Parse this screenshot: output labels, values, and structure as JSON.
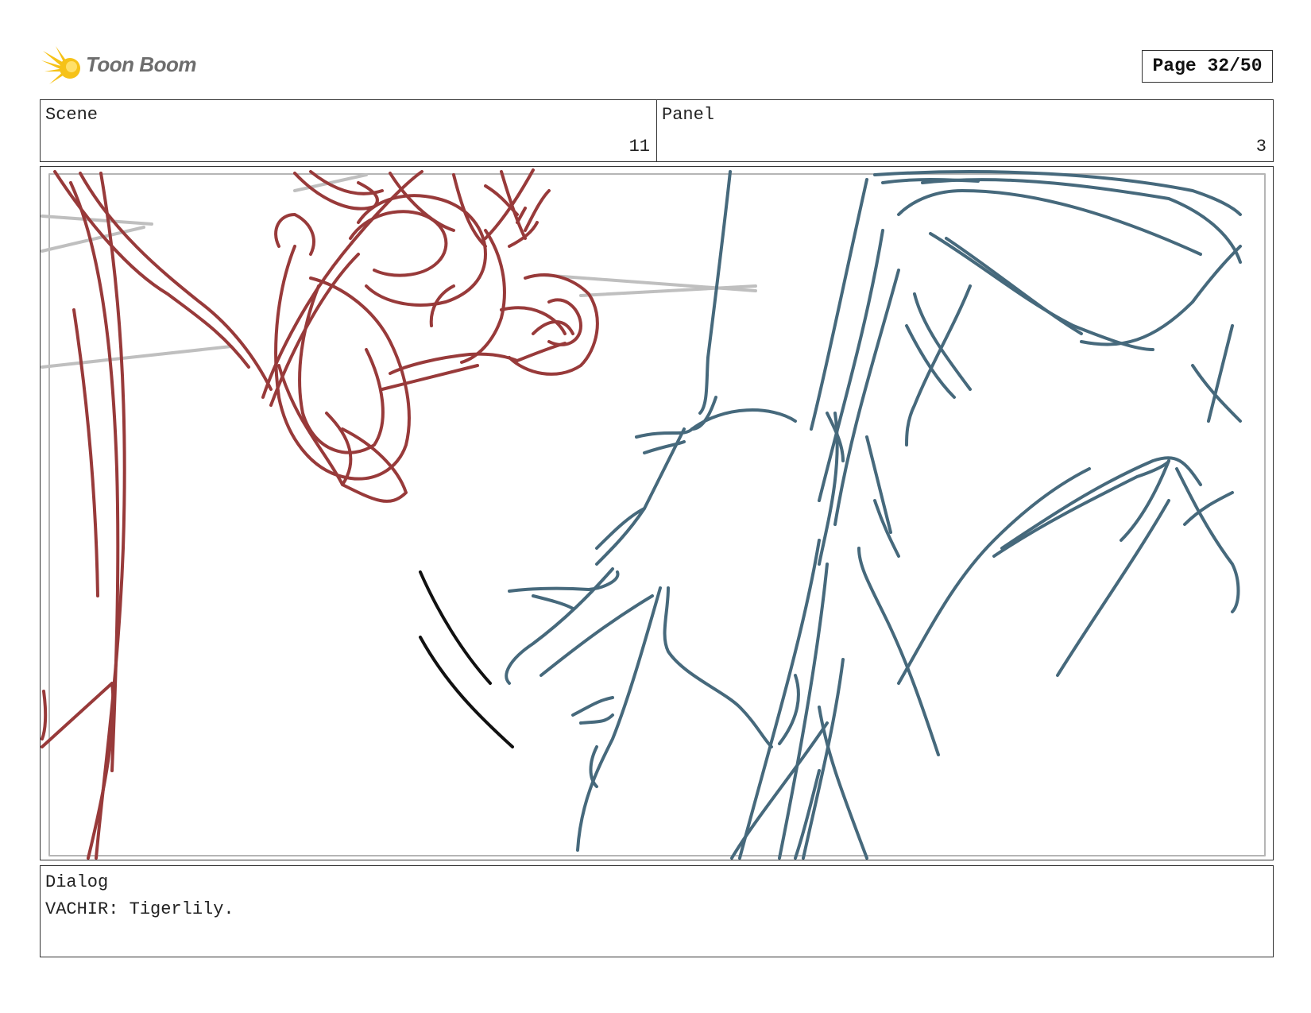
{
  "header": {
    "logo_text": "Toon Boom",
    "page_label": "Page 32/50"
  },
  "fields": {
    "scene_label": "Scene",
    "scene_value": "11",
    "panel_label": "Panel",
    "panel_value": "3"
  },
  "panel": {
    "colors": {
      "character_left": "#983a3a",
      "character_right": "#46697c",
      "speed_lines": "#111111",
      "guide_lines": "#bfbfbf"
    }
  },
  "dialog": {
    "label": "Dialog",
    "text": "VACHIR: Tigerlily."
  }
}
